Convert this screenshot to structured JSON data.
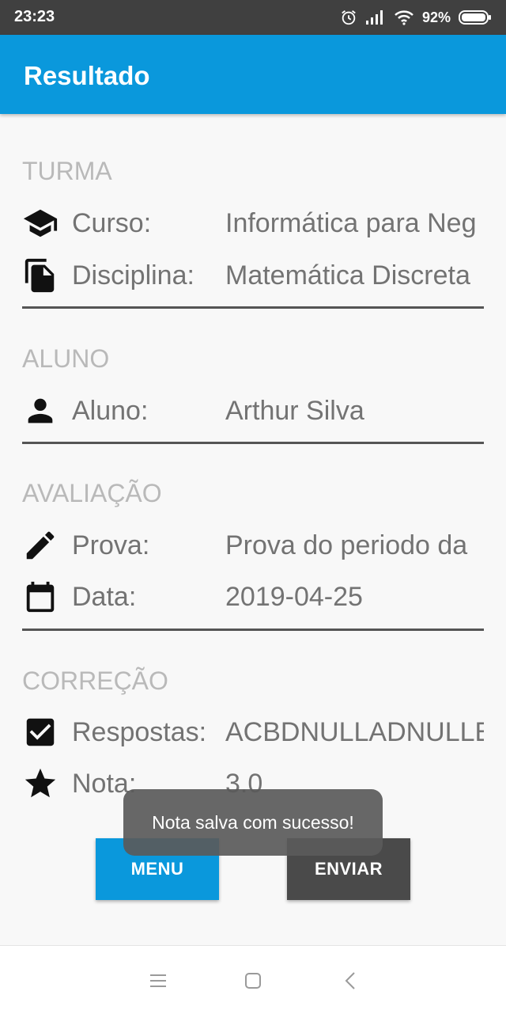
{
  "status_bar": {
    "time": "23:23",
    "battery_percent": "92%",
    "icons": [
      "alarm-icon",
      "signal-icon",
      "wifi-icon",
      "battery-icon"
    ]
  },
  "app_bar": {
    "title": "Resultado",
    "color": "#0a98dc"
  },
  "sections": {
    "turma": {
      "header": "TURMA",
      "curso": {
        "label": "Curso:",
        "value": "Informática para Neg",
        "icon": "graduation-cap-icon"
      },
      "disciplina": {
        "label": "Disciplina:",
        "value": "Matemática Discreta",
        "icon": "file-copy-icon"
      }
    },
    "aluno": {
      "header": "ALUNO",
      "aluno": {
        "label": "Aluno:",
        "value": "Arthur Silva",
        "icon": "person-icon"
      }
    },
    "avaliacao": {
      "header": "AVALIAÇÃO",
      "prova": {
        "label": "Prova:",
        "value": "Prova do periodo da",
        "icon": "pencil-icon"
      },
      "data": {
        "label": "Data:",
        "value": "2019-04-25",
        "icon": "calendar-icon"
      }
    },
    "correcao": {
      "header": "CORREÇÃO",
      "respostas": {
        "label": "Respostas:",
        "value": "ACBDNULLADNULLE",
        "icon": "checkbox-icon"
      },
      "nota": {
        "label": "Nota:",
        "value": "3.0",
        "icon": "star-icon"
      }
    }
  },
  "buttons": {
    "menu": "MENU",
    "enviar": "ENVIAR"
  },
  "toast": {
    "message": "Nota salva com sucesso!"
  },
  "nav_bar": {
    "icons": [
      "menu-icon",
      "home-icon",
      "back-icon"
    ]
  }
}
